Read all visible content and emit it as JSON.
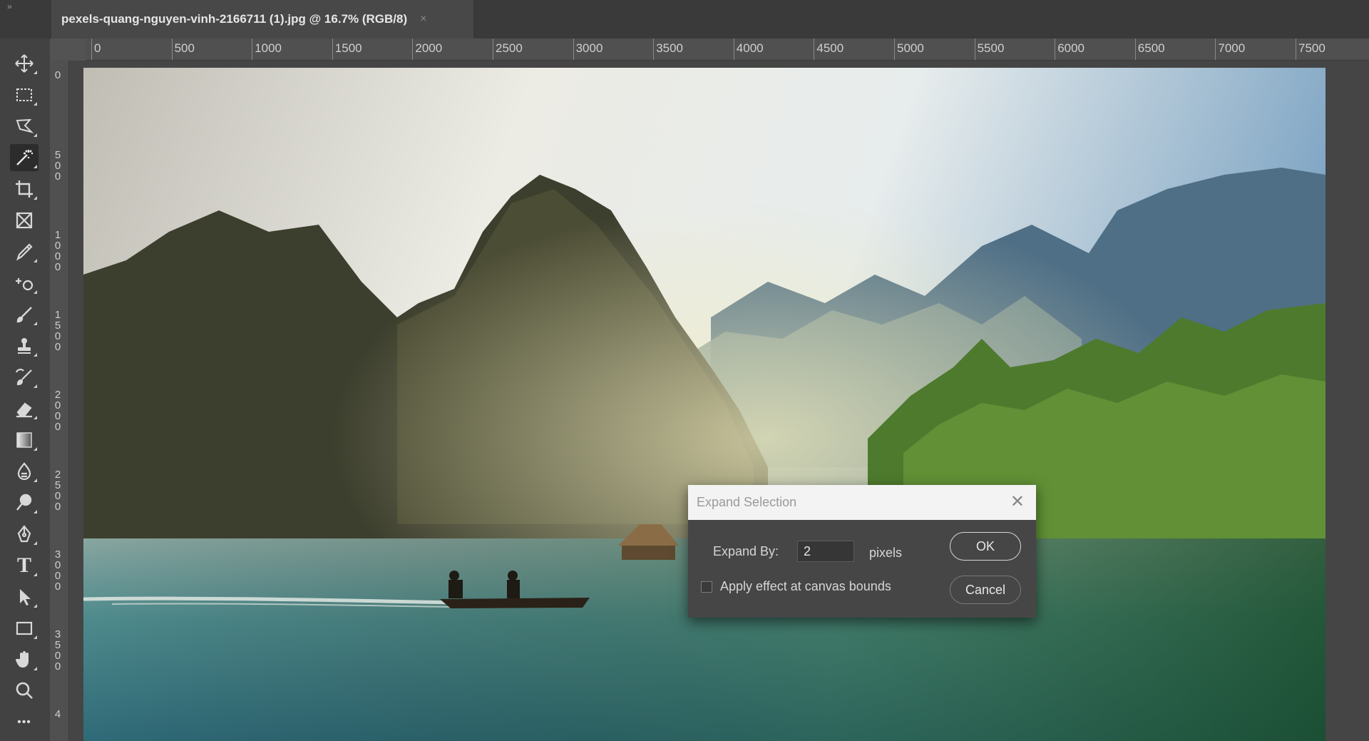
{
  "document_tab": {
    "title": "pexels-quang-nguyen-vinh-2166711 (1).jpg @ 16.7% (RGB/8)",
    "close_glyph": "×"
  },
  "panel_collapse_glyph": "»",
  "toolbar": {
    "tools": [
      {
        "name": "move-tool",
        "icon": "move-icon"
      },
      {
        "name": "rectangular-marquee-tool",
        "icon": "marquee-icon"
      },
      {
        "name": "lasso-tool",
        "icon": "polygonal-lasso-icon"
      },
      {
        "name": "magic-wand-tool",
        "icon": "magic-wand-icon",
        "active": true
      },
      {
        "name": "crop-tool",
        "icon": "crop-icon"
      },
      {
        "name": "frame-tool",
        "icon": "frame-icon"
      },
      {
        "name": "eyedropper-tool",
        "icon": "eyedropper-icon"
      },
      {
        "name": "spot-healing-tool",
        "icon": "healing-icon"
      },
      {
        "name": "brush-tool",
        "icon": "brush-icon"
      },
      {
        "name": "clone-stamp-tool",
        "icon": "stamp-icon"
      },
      {
        "name": "history-brush-tool",
        "icon": "history-brush-icon"
      },
      {
        "name": "eraser-tool",
        "icon": "eraser-icon"
      },
      {
        "name": "gradient-tool",
        "icon": "gradient-icon"
      },
      {
        "name": "blur-tool",
        "icon": "blur-icon"
      },
      {
        "name": "dodge-tool",
        "icon": "dodge-icon"
      },
      {
        "name": "pen-tool",
        "icon": "pen-icon"
      },
      {
        "name": "type-tool",
        "icon": "type-icon"
      },
      {
        "name": "path-selection-tool",
        "icon": "arrow-icon"
      },
      {
        "name": "rectangle-tool",
        "icon": "rectangle-icon"
      },
      {
        "name": "hand-tool",
        "icon": "hand-icon"
      },
      {
        "name": "zoom-tool",
        "icon": "zoom-icon"
      },
      {
        "name": "edit-toolbar",
        "icon": "more-icon"
      }
    ],
    "type_glyph": "T",
    "more_glyph": "•••"
  },
  "rulers": {
    "horizontal": [
      "0",
      "500",
      "1000",
      "1500",
      "2000",
      "2500",
      "3000",
      "3500",
      "4000",
      "4500",
      "5000",
      "5500",
      "6000",
      "6500",
      "7000",
      "7500"
    ],
    "vertical": [
      "0",
      "500",
      "1000",
      "1500",
      "2000",
      "2500",
      "3000",
      "3500",
      "4"
    ]
  },
  "dialog": {
    "title": "Expand Selection",
    "close_glyph": "✕",
    "expand_label": "Expand By:",
    "expand_value": "2",
    "unit": "pixels",
    "canvas_bounds_label": "Apply effect at canvas bounds",
    "canvas_bounds_checked": false,
    "ok_label": "OK",
    "cancel_label": "Cancel"
  }
}
